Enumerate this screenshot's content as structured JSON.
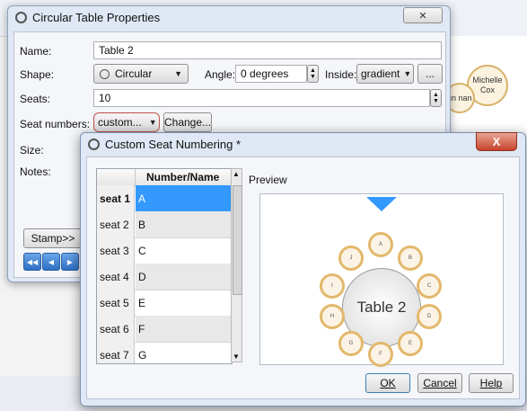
{
  "background": {
    "seat_names": [
      "Michelle Cox",
      "tin nan"
    ]
  },
  "table_dialog": {
    "title": "Circular Table Properties",
    "name_label": "Name:",
    "name_value": "Table 2",
    "shape_label": "Shape:",
    "shape_value": "Circular",
    "angle_label": "Angle:",
    "angle_value": "0 degrees",
    "inside_label": "Inside:",
    "inside_value": "gradient",
    "ellipsis_label": "...",
    "seats_label": "Seats:",
    "seats_value": "10",
    "seat_numbers_label": "Seat numbers:",
    "seat_numbers_value": "custom...",
    "change_label": "Change...",
    "size_label": "Size:",
    "notes_label": "Notes:",
    "stamp_label": "Stamp>>"
  },
  "seat_numbering_dialog": {
    "title": "Custom Seat Numbering *",
    "close_label": "X",
    "column_header": "Number/Name",
    "rows": [
      {
        "seat": "seat 1",
        "name": "A",
        "selected": true
      },
      {
        "seat": "seat 2",
        "name": "B"
      },
      {
        "seat": "seat 3",
        "name": "C"
      },
      {
        "seat": "seat 4",
        "name": "D"
      },
      {
        "seat": "seat 5",
        "name": "E"
      },
      {
        "seat": "seat 6",
        "name": "F"
      },
      {
        "seat": "seat 7",
        "name": "G"
      }
    ],
    "preview_label": "Preview",
    "preview_table_name": "Table 2",
    "preview_seats": [
      "A",
      "B",
      "C",
      "D",
      "E",
      "F",
      "G",
      "H",
      "I",
      "J"
    ],
    "ok_label": "OK",
    "cancel_label": "Cancel",
    "help_label": "Help"
  },
  "colors": {
    "accent": "#3399ff",
    "seat_border": "#e3b86c",
    "close_red": "#c6452b"
  }
}
